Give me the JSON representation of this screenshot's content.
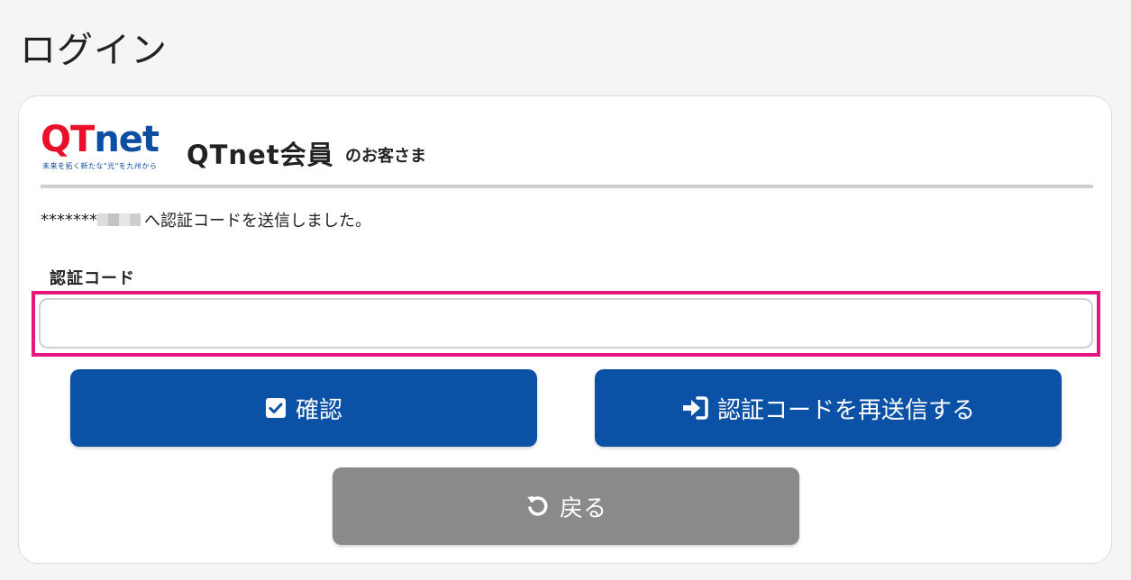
{
  "page": {
    "title": "ログイン"
  },
  "brand": {
    "logo_q": "Q",
    "logo_t": "T",
    "logo_net": "net",
    "logo_tagline": "未来を拓く新たな\"光\"を九州から",
    "name": "QTnet会員",
    "suffix": "のお客さま",
    "colors": {
      "red": "#e8102b",
      "blue": "#0b4ea2"
    }
  },
  "message": {
    "prefix": "*******",
    "text": "へ認証コードを送信しました。"
  },
  "form": {
    "code_label": "認証コード",
    "code_value": "",
    "code_placeholder": "",
    "highlight_color": "#e6187f"
  },
  "buttons": {
    "confirm": {
      "label": "確認",
      "icon": "checkbox-checked-icon"
    },
    "resend": {
      "label": "認証コードを再送信する",
      "icon": "sign-in-arrow-icon"
    },
    "back": {
      "label": "戻る",
      "icon": "undo-arrow-icon"
    }
  },
  "colors": {
    "primary": "#0b52a6",
    "secondary": "#8a8a8a"
  }
}
